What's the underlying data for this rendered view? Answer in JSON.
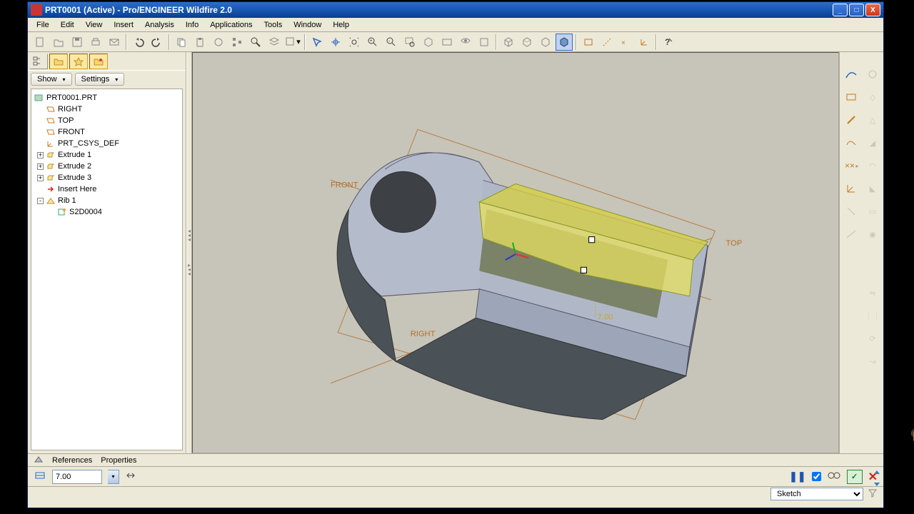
{
  "titlebar": {
    "title": "PRT0001 (Active) - Pro/ENGINEER Wildfire 2.0"
  },
  "menu": [
    "File",
    "Edit",
    "View",
    "Insert",
    "Analysis",
    "Info",
    "Applications",
    "Tools",
    "Window",
    "Help"
  ],
  "nav": {
    "show": "Show",
    "settings": "Settings"
  },
  "tree": {
    "root": "PRT0001.PRT",
    "n1": "RIGHT",
    "n2": "TOP",
    "n3": "FRONT",
    "n4": "PRT_CSYS_DEF",
    "n5": "Extrude 1",
    "n6": "Extrude 2",
    "n7": "Extrude 3",
    "n8": "Insert Here",
    "n9": "Rib 1",
    "n10": "S2D0004"
  },
  "dashboard": {
    "references": "References",
    "properties": "Properties"
  },
  "input": {
    "value": "7.00"
  },
  "graphics": {
    "front": "FRONT",
    "top": "TOP",
    "right": "RIGHT",
    "csys": "PRT_CSYS_DEF",
    "dim": "7.00"
  },
  "status": {
    "selection": "Sketch"
  },
  "confirm": {
    "ok": "✓",
    "cancel": "✕",
    "pause": "❚❚"
  }
}
